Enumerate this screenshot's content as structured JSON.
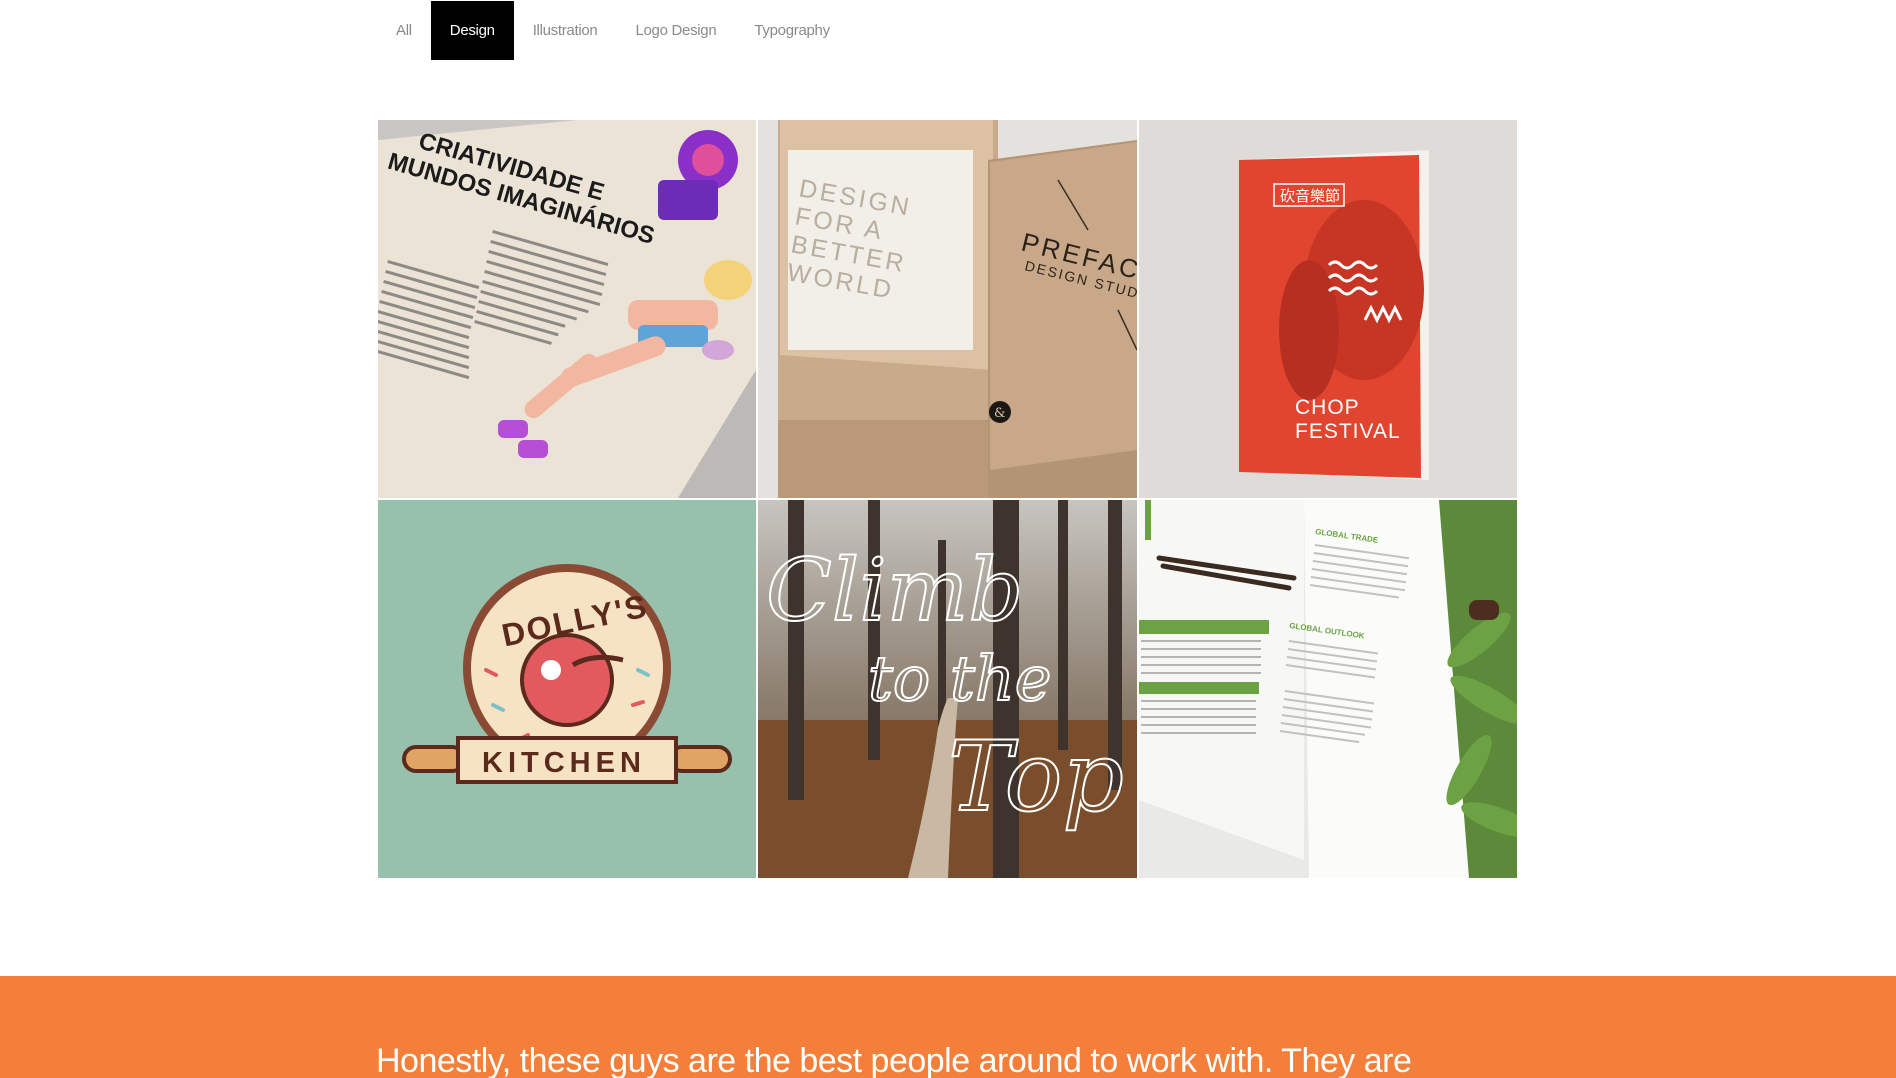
{
  "filters": {
    "items": [
      {
        "label": "All"
      },
      {
        "label": "Design"
      },
      {
        "label": "Illustration"
      },
      {
        "label": "Logo Design"
      },
      {
        "label": "Typography"
      }
    ],
    "active": "Design"
  },
  "portfolio": {
    "tiles": [
      {
        "subject": "magazine-spread",
        "headline": [
          "CRIATIVIDADE E",
          "MUNDOS IMAGINÁRIOS"
        ]
      },
      {
        "subject": "business-cards",
        "card_text": [
          "DESIGN",
          "FOR A",
          "BETTER",
          "WORLD"
        ],
        "brand": "PREFAC",
        "tagline": "DESIGN STUDIO",
        "monogram": "&"
      },
      {
        "subject": "festival-booklet",
        "badge": "砍音樂節",
        "title": [
          "CHOP",
          "FESTIVAL"
        ]
      },
      {
        "subject": "bakery-logo",
        "name_top": "DOLLY'S",
        "name_bottom": "KITCHEN"
      },
      {
        "subject": "forest-lettering",
        "script": [
          "Climb",
          "to the",
          "Top"
        ]
      },
      {
        "subject": "report-spread",
        "heading_1": "GLOBAL TRADE",
        "heading_2": "GLOBAL OUTLOOK"
      }
    ]
  },
  "testimonial": {
    "quote": "Honestly, these guys are the best people around to work with. They are"
  },
  "colors": {
    "accent": "#f47f3a",
    "filter_active_bg": "#000000",
    "filter_text": "#8a8a8a"
  }
}
